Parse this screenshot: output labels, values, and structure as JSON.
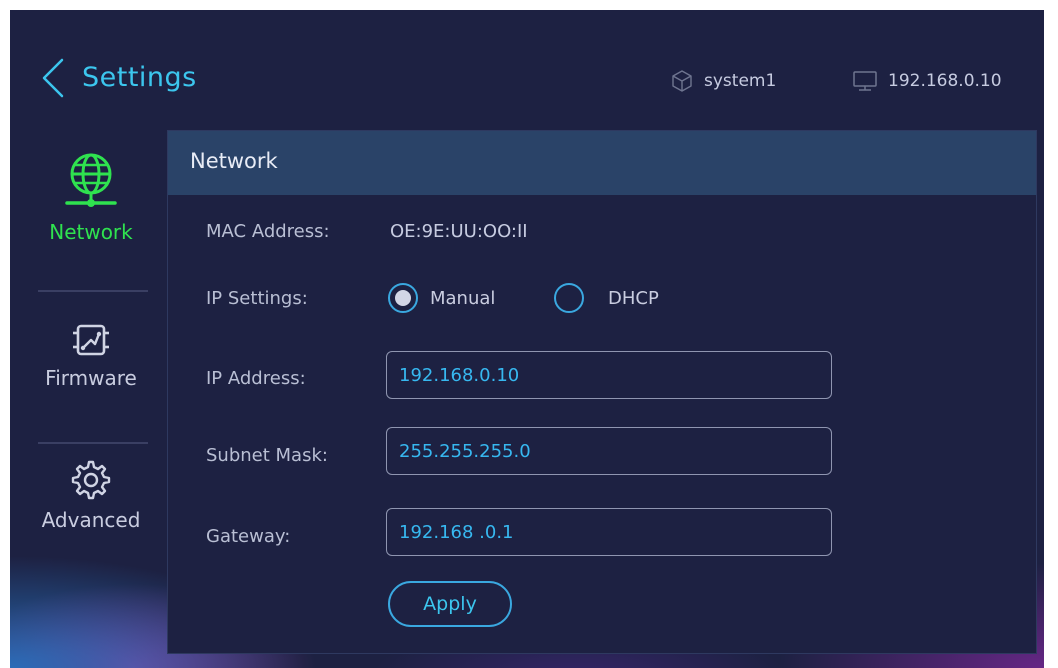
{
  "header": {
    "title": "Settings",
    "system_name": "system1",
    "device_ip": "192.168.0.10"
  },
  "sidebar": {
    "items": [
      {
        "label": "Network",
        "icon": "globe-network-icon",
        "active": true
      },
      {
        "label": "Firmware",
        "icon": "chip-icon",
        "active": false
      },
      {
        "label": "Advanced",
        "icon": "gear-icon",
        "active": false
      }
    ]
  },
  "network": {
    "title": "Network",
    "mac_label": "MAC Address:",
    "mac_value": "OE:9E:UU:OO:II",
    "ip_settings_label": "IP Settings:",
    "ip_mode_options": [
      "Manual",
      "DHCP"
    ],
    "ip_mode_selected": "Manual",
    "ip_address_label": "IP Address:",
    "ip_address_value": "192.168.0.10",
    "subnet_label": "Subnet Mask:",
    "subnet_value": "255.255.255.0",
    "gateway_label": "Gateway:",
    "gateway_value": "192.168 .0.1",
    "apply_label": "Apply"
  },
  "colors": {
    "accent_cyan": "#3cc6ee",
    "active_green": "#2fe24f",
    "background": "#1d2142",
    "panel_header": "#2a4368"
  }
}
